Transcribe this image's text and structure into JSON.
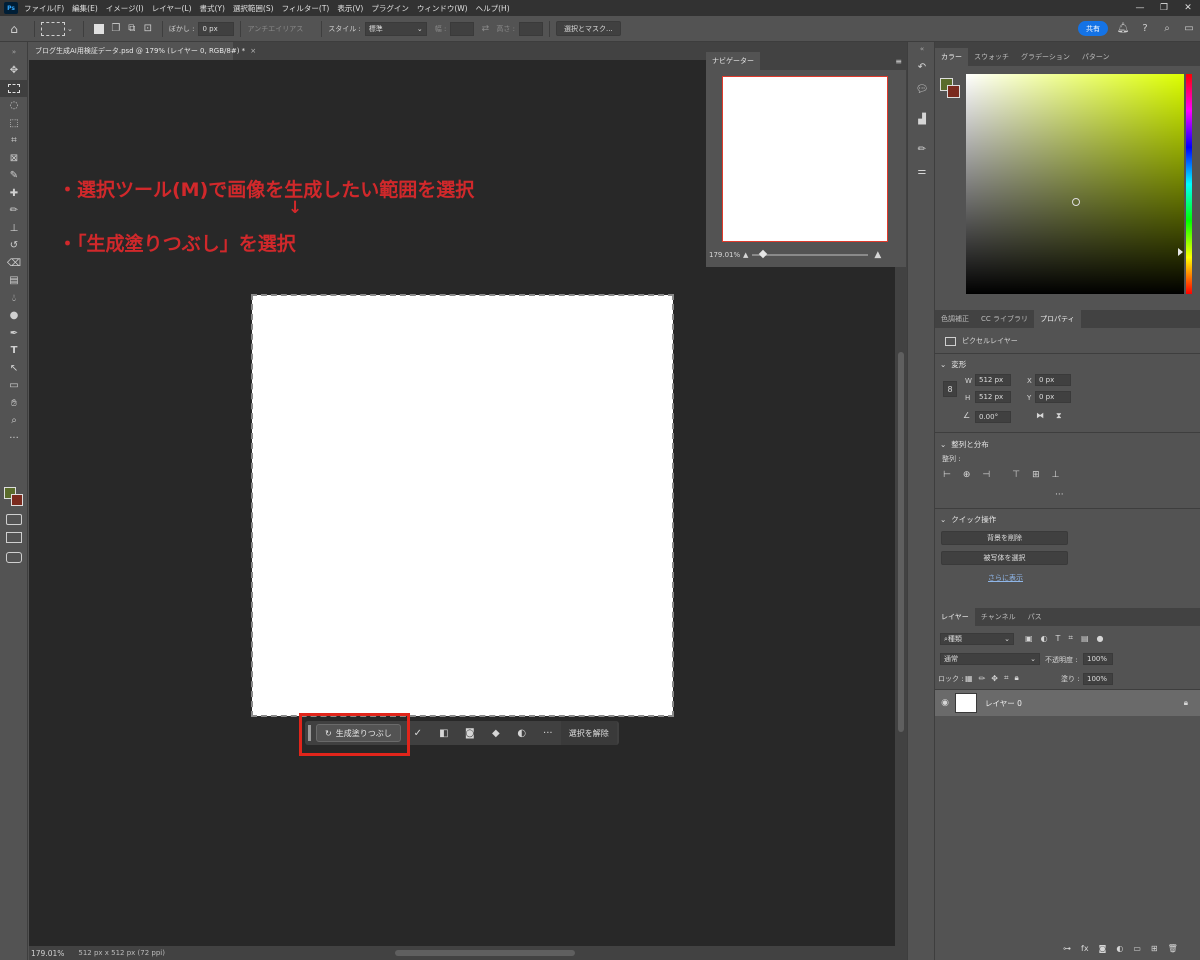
{
  "menubar": {
    "logo": "Ps",
    "items": [
      "ファイル(F)",
      "編集(E)",
      "イメージ(I)",
      "レイヤー(L)",
      "書式(Y)",
      "選択範囲(S)",
      "フィルター(T)",
      "表示(V)",
      "プラグイン",
      "ウィンドウ(W)",
      "ヘルプ(H)"
    ],
    "controls": [
      "—",
      "❐",
      "✕"
    ]
  },
  "options": {
    "feather_label": "ぼかし :",
    "feather_value": "0 px",
    "antialias_label": "アンチエイリアス",
    "style_label": "スタイル :",
    "style_value": "標準",
    "width_label": "幅 :",
    "height_label": "高さ :",
    "select_mask_button": "選択とマスク...",
    "share_button": "共有"
  },
  "document": {
    "tab_title": "ブログ生成AI用検証データ.psd @ 179% (レイヤー 0, RGB/8#) *",
    "tab_close": "×"
  },
  "annotation": {
    "line1": "・選択ツール(M)で画像を生成したい範囲を選択",
    "arrow": "↓",
    "line2": "・「生成塗りつぶし」を選択"
  },
  "taskbar": {
    "generative_fill": "生成塗りつぶし",
    "more": "···",
    "deselect": "選択を解除"
  },
  "status": {
    "zoom": "179.01%",
    "dimensions": "512 px x 512 px (72 ppi)"
  },
  "navigator": {
    "tab": "ナビゲーター",
    "zoom": "179.01%"
  },
  "color_panel": {
    "tabs": [
      "カラー",
      "スウォッチ",
      "グラデーション",
      "パターン"
    ],
    "fg_color": "#5a6b2a",
    "bg_color": "#7a2a1e",
    "hue_color": "#ddff00"
  },
  "properties": {
    "tabs": [
      "色調補正",
      "CC ライブラリ",
      "プロパティ"
    ],
    "layer_type": "ピクセルレイヤー",
    "transform_header": "変形",
    "w_label": "W",
    "w_value": "512 px",
    "h_label": "H",
    "h_value": "512 px",
    "x_label": "X",
    "x_value": "0 px",
    "y_label": "Y",
    "y_value": "0 px",
    "angle_value": "0.00°",
    "align_header": "整列と分布",
    "align_label": "整列 :",
    "align_more": "···",
    "quick_header": "クイック操作",
    "remove_bg": "背景を削除",
    "select_subject": "被写体を選択",
    "show_more": "さらに表示"
  },
  "layers": {
    "tabs": [
      "レイヤー",
      "チャンネル",
      "パス"
    ],
    "filter_kind": "種類",
    "blend_mode": "通常",
    "opacity_label": "不透明度 :",
    "opacity_value": "100%",
    "lock_label": "ロック :",
    "fill_label": "塗り :",
    "fill_value": "100%",
    "layer_name": "レイヤー 0"
  }
}
